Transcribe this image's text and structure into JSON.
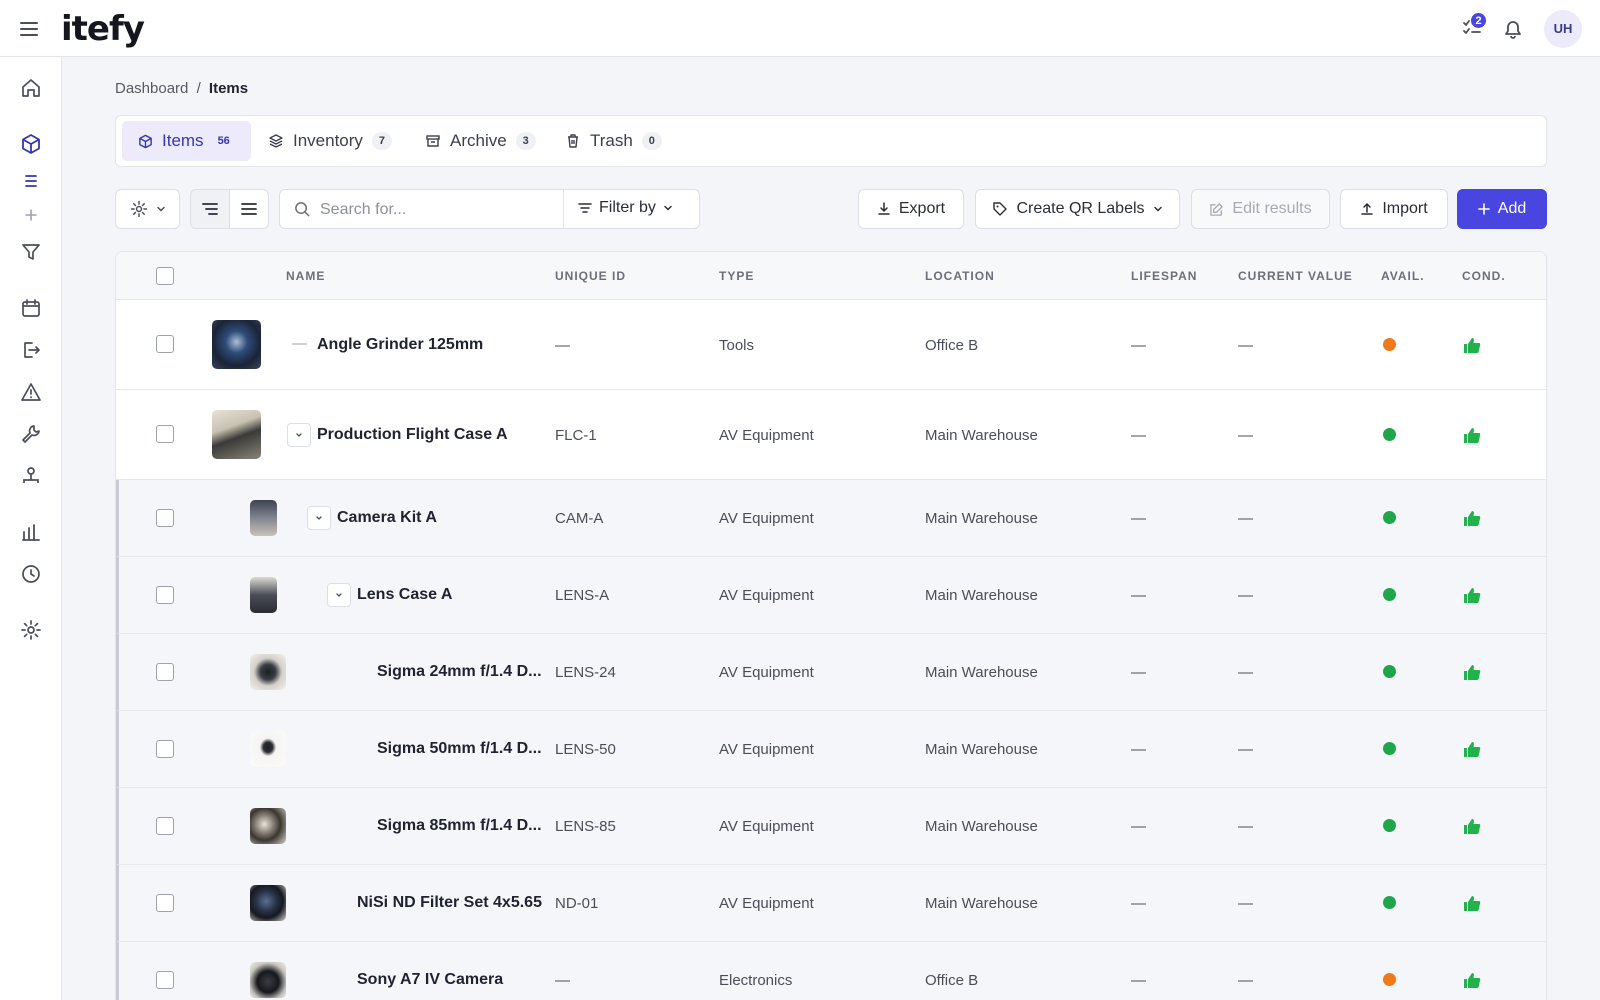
{
  "header": {
    "logo": "itefy",
    "notification_count": "2",
    "avatar_initials": "UH"
  },
  "breadcrumb": {
    "root": "Dashboard",
    "separator": "/",
    "current": "Items"
  },
  "tabs": [
    {
      "label": "Items",
      "count": "56",
      "icon": "cube-icon",
      "active": true
    },
    {
      "label": "Inventory",
      "count": "7",
      "icon": "layers-icon",
      "active": false
    },
    {
      "label": "Archive",
      "count": "3",
      "icon": "archive-icon",
      "active": false
    },
    {
      "label": "Trash",
      "count": "0",
      "icon": "trash-icon",
      "active": false
    }
  ],
  "toolbar": {
    "search_placeholder": "Search for...",
    "filter_label": "Filter by",
    "export_label": "Export",
    "qr_label": "Create QR Labels",
    "edit_label": "Edit results",
    "import_label": "Import",
    "add_label": "Add"
  },
  "table": {
    "columns": [
      "NAME",
      "UNIQUE ID",
      "TYPE",
      "LOCATION",
      "LIFESPAN",
      "CURRENT VALUE",
      "AVAIL.",
      "COND."
    ],
    "rows": [
      {
        "name": "Angle Grinder 125mm",
        "uid": "—",
        "type": "Tools",
        "location": "Office B",
        "lifespan": "—",
        "value": "—",
        "avail": "orange"
      },
      {
        "name": "Production Flight Case A",
        "uid": "FLC-1",
        "type": "AV Equipment",
        "location": "Main Warehouse",
        "lifespan": "—",
        "value": "—",
        "avail": "green"
      },
      {
        "name": "Camera Kit A",
        "uid": "CAM-A",
        "type": "AV Equipment",
        "location": "Main Warehouse",
        "lifespan": "—",
        "value": "—",
        "avail": "green"
      },
      {
        "name": "Lens Case A",
        "uid": "LENS-A",
        "type": "AV Equipment",
        "location": "Main Warehouse",
        "lifespan": "—",
        "value": "—",
        "avail": "green"
      },
      {
        "name": "Sigma 24mm f/1.4 D...",
        "uid": "LENS-24",
        "type": "AV Equipment",
        "location": "Main Warehouse",
        "lifespan": "—",
        "value": "—",
        "avail": "green"
      },
      {
        "name": "Sigma 50mm f/1.4 D...",
        "uid": "LENS-50",
        "type": "AV Equipment",
        "location": "Main Warehouse",
        "lifespan": "—",
        "value": "—",
        "avail": "green"
      },
      {
        "name": "Sigma 85mm f/1.4 D...",
        "uid": "LENS-85",
        "type": "AV Equipment",
        "location": "Main Warehouse",
        "lifespan": "—",
        "value": "—",
        "avail": "green"
      },
      {
        "name": "NiSi ND Filter Set 4x5.65",
        "uid": "ND-01",
        "type": "AV Equipment",
        "location": "Main Warehouse",
        "lifespan": "—",
        "value": "—",
        "avail": "green"
      },
      {
        "name": "Sony A7 IV Camera",
        "uid": "—",
        "type": "Electronics",
        "location": "Office B",
        "lifespan": "—",
        "value": "—",
        "avail": "orange"
      }
    ]
  },
  "colors": {
    "accent": "#4845e0",
    "avail_green": "#1fa64a",
    "avail_orange": "#f07a1a",
    "cond_good": "#22b24c"
  }
}
